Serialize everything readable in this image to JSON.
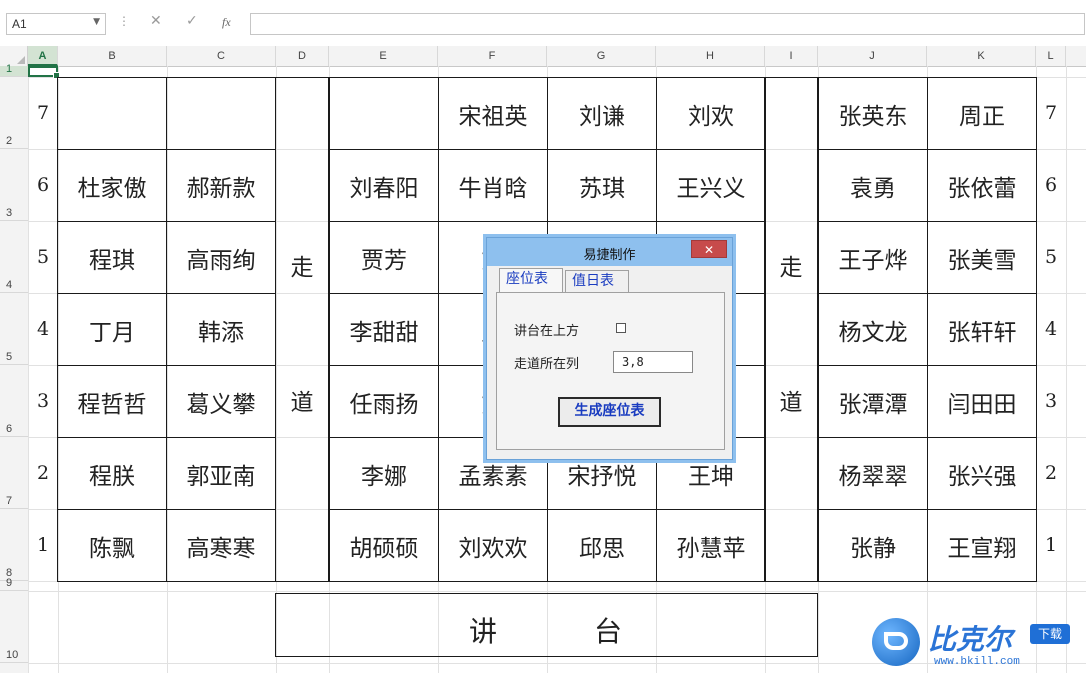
{
  "formula_bar": {
    "name_box": "A1",
    "cancel_icon": "✕",
    "enter_icon": "✓",
    "fx_label": "fx",
    "formula": ""
  },
  "columns": [
    "A",
    "B",
    "C",
    "D",
    "E",
    "F",
    "G",
    "H",
    "I",
    "J",
    "K",
    "L"
  ],
  "rows": [
    "1",
    "2",
    "3",
    "4",
    "5",
    "6",
    "7",
    "8",
    "9",
    "10"
  ],
  "seat_rows": [
    {
      "num": "7",
      "cells": [
        "",
        "",
        "",
        "宋祖英",
        "刘谦",
        "刘欢",
        "张英东",
        "周正"
      ]
    },
    {
      "num": "6",
      "cells": [
        "杜家傲",
        "郝新款",
        "刘春阳",
        "牛肖晗",
        "苏琪",
        "王兴义",
        "袁勇",
        "张依蕾"
      ]
    },
    {
      "num": "5",
      "cells": [
        "程琪",
        "高雨绚",
        "贾芳",
        "刘",
        "",
        "双",
        "王子烨",
        "张美雪"
      ]
    },
    {
      "num": "4",
      "cells": [
        "丁月",
        "韩添",
        "李甜甜",
        "孟",
        "",
        "",
        "杨文龙",
        "张轩轩"
      ]
    },
    {
      "num": "3",
      "cells": [
        "程哲哲",
        "葛义攀",
        "任雨扬",
        "刘",
        "",
        "",
        "张潭潭",
        "闫田田"
      ]
    },
    {
      "num": "2",
      "cells": [
        "程朕",
        "郭亚南",
        "李娜",
        "孟素素",
        "宋抒悦",
        "王坤",
        "杨翠翠",
        "张兴强"
      ]
    },
    {
      "num": "1",
      "cells": [
        "陈飘",
        "高寒寒",
        "胡硕硕",
        "刘欢欢",
        "邱思",
        "孙慧苹",
        "张静",
        "王宣翔"
      ]
    }
  ],
  "aisle": {
    "top": "走",
    "bottom": "道"
  },
  "podium": {
    "left": "讲",
    "right": "台"
  },
  "dialog": {
    "title": "易捷制作",
    "close": "✕",
    "tabs": [
      "座位表",
      "值日表"
    ],
    "podium_top_label": "讲台在上方",
    "podium_top_checked": false,
    "aisle_label": "走道所在列",
    "aisle_value": "3,8",
    "generate_button": "生成座位表"
  },
  "watermark": {
    "brand": "比克尔",
    "badge": "下载",
    "url": "www.bkill.com"
  }
}
